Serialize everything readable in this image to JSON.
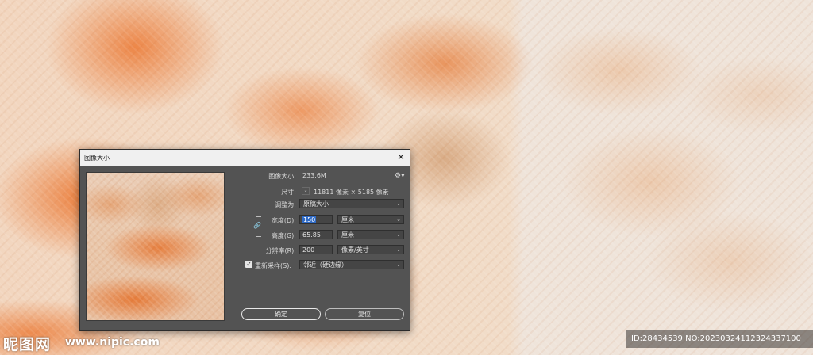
{
  "dialog": {
    "title": "图像大小",
    "close_glyph": "✕",
    "image_size_label": "图像大小:",
    "image_size_value": "233.6M",
    "dimensions_label": "尺寸:",
    "dimensions_value": "11811 像素 × 5185 像素",
    "fit_to_label": "调整为:",
    "fit_to_value": "原稿大小",
    "width_label": "宽度(D):",
    "width_value": "150",
    "width_unit": "厘米",
    "height_label": "高度(G):",
    "height_value": "65.85",
    "height_unit": "厘米",
    "resolution_label": "分辨率(R):",
    "resolution_value": "200",
    "resolution_unit": "像素/英寸",
    "resample_label": "重新采样(S):",
    "resample_checked": true,
    "resample_value": "邻近（硬边缘）",
    "ok_label": "确定",
    "reset_label": "复位"
  },
  "icons": {
    "gear": "gear-icon",
    "link": "chain-link-icon",
    "dropdown": "chevron-down-icon"
  },
  "watermark": {
    "logo_text": "昵图网",
    "url_text": "www.nipic.com",
    "id_text": "ID:28434539 NO:20230324112324337100"
  }
}
